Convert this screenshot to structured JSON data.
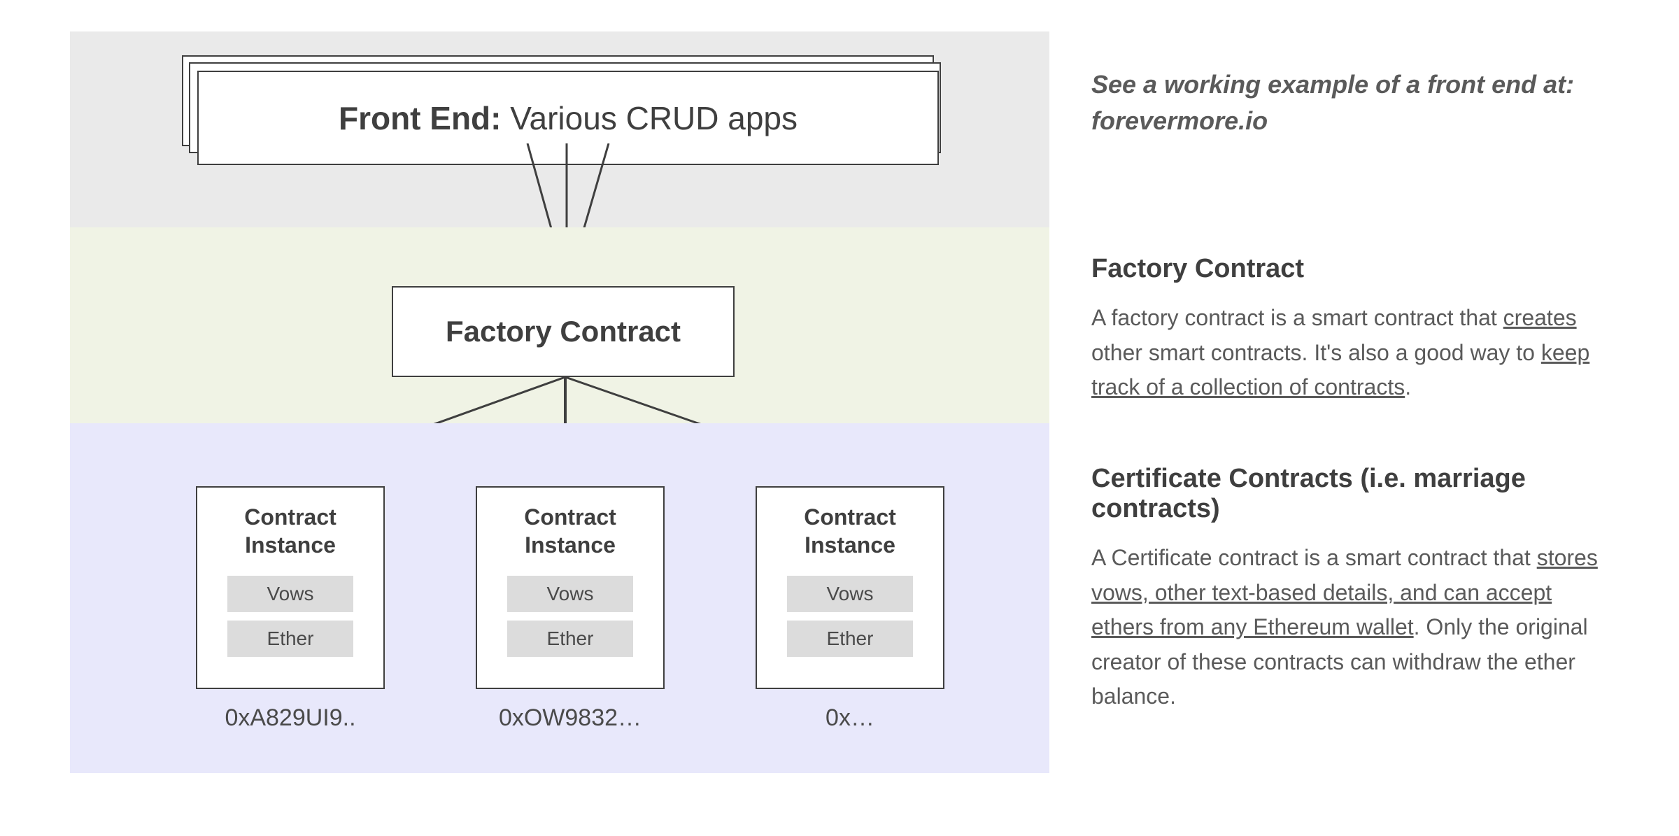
{
  "frontend": {
    "label_bold": "Front End:",
    "label_rest": " Various CRUD apps",
    "note_line1": "See a working example of a front end at: ",
    "note_line2": "forevermore.io"
  },
  "factory": {
    "box_label": "Factory Contract",
    "heading": "Factory Contract",
    "body_pre": "A factory contract is a smart contract that ",
    "body_u1": "creates",
    "body_mid": " other smart contracts. It's also a good way to ",
    "body_u2": "keep track of a collection of contracts",
    "body_post": "."
  },
  "certificates": {
    "heading": "Certificate Contracts (i.e. marriage contracts)",
    "body_pre": "A Certificate contract is a smart contract that ",
    "body_u1": "stores vows, other text-based details, and can accept ethers from any Ethereum wallet",
    "body_post": ". Only the original creator of these contracts can withdraw the ether balance.",
    "instances": [
      {
        "title": "Contract Instance",
        "chip1": "Vows",
        "chip2": "Ether",
        "addr": "0xA829UI9.."
      },
      {
        "title": "Contract Instance",
        "chip1": "Vows",
        "chip2": "Ether",
        "addr": "0xOW9832…"
      },
      {
        "title": "Contract Instance",
        "chip1": "Vows",
        "chip2": "Ether",
        "addr": "0x…"
      }
    ]
  }
}
